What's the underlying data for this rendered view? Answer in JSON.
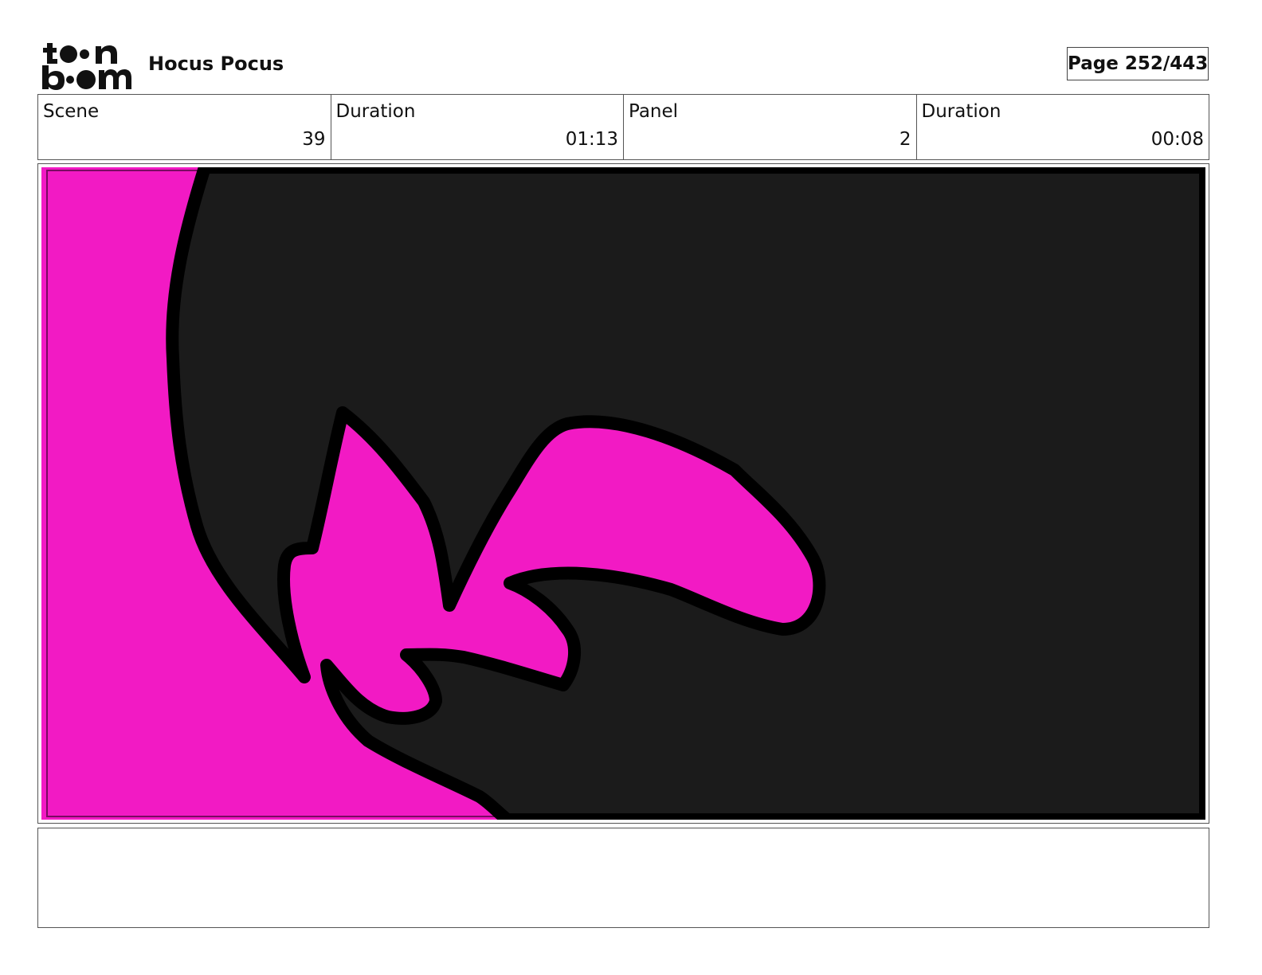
{
  "header": {
    "title": "Hocus Pocus",
    "page_label": "Page 252/443"
  },
  "info": {
    "scene_label": "Scene",
    "scene_value": "39",
    "scene_duration_label": "Duration",
    "scene_duration_value": "01:13",
    "panel_label": "Panel",
    "panel_value": "2",
    "panel_duration_label": "Duration",
    "panel_duration_value": "00:08"
  },
  "colors": {
    "magenta": "#f21ac4",
    "dark": "#1b1b1b",
    "ink": "#000000"
  },
  "notes": {
    "text": ""
  }
}
